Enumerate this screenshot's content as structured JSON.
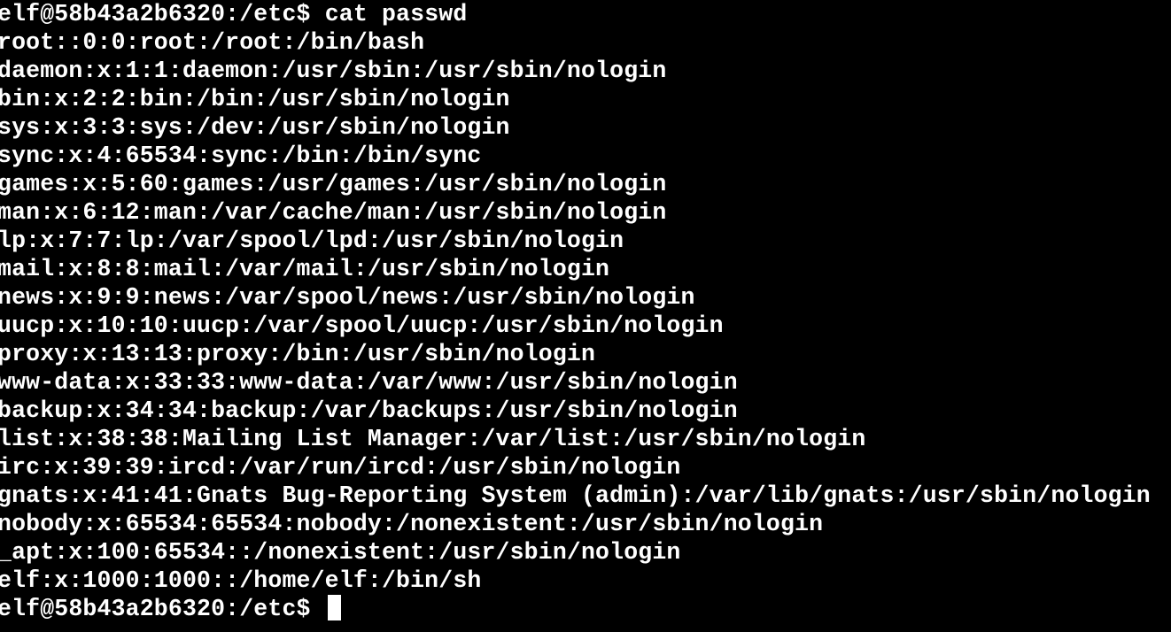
{
  "terminal": {
    "prompt": "elf@58b43a2b6320:/etc$",
    "command": "cat passwd",
    "output": [
      "root::0:0:root:/root:/bin/bash",
      "daemon:x:1:1:daemon:/usr/sbin:/usr/sbin/nologin",
      "bin:x:2:2:bin:/bin:/usr/sbin/nologin",
      "sys:x:3:3:sys:/dev:/usr/sbin/nologin",
      "sync:x:4:65534:sync:/bin:/bin/sync",
      "games:x:5:60:games:/usr/games:/usr/sbin/nologin",
      "man:x:6:12:man:/var/cache/man:/usr/sbin/nologin",
      "lp:x:7:7:lp:/var/spool/lpd:/usr/sbin/nologin",
      "mail:x:8:8:mail:/var/mail:/usr/sbin/nologin",
      "news:x:9:9:news:/var/spool/news:/usr/sbin/nologin",
      "uucp:x:10:10:uucp:/var/spool/uucp:/usr/sbin/nologin",
      "proxy:x:13:13:proxy:/bin:/usr/sbin/nologin",
      "www-data:x:33:33:www-data:/var/www:/usr/sbin/nologin",
      "backup:x:34:34:backup:/var/backups:/usr/sbin/nologin",
      "list:x:38:38:Mailing List Manager:/var/list:/usr/sbin/nologin",
      "irc:x:39:39:ircd:/var/run/ircd:/usr/sbin/nologin",
      "gnats:x:41:41:Gnats Bug-Reporting System (admin):/var/lib/gnats:/usr/sbin/nologin",
      "nobody:x:65534:65534:nobody:/nonexistent:/usr/sbin/nologin",
      "_apt:x:100:65534::/nonexistent:/usr/sbin/nologin",
      "elf:x:1000:1000::/home/elf:/bin/sh"
    ],
    "final_prompt": "elf@58b43a2b6320:/etc$",
    "colors": {
      "background": "#000000",
      "foreground": "#ffffff"
    }
  }
}
